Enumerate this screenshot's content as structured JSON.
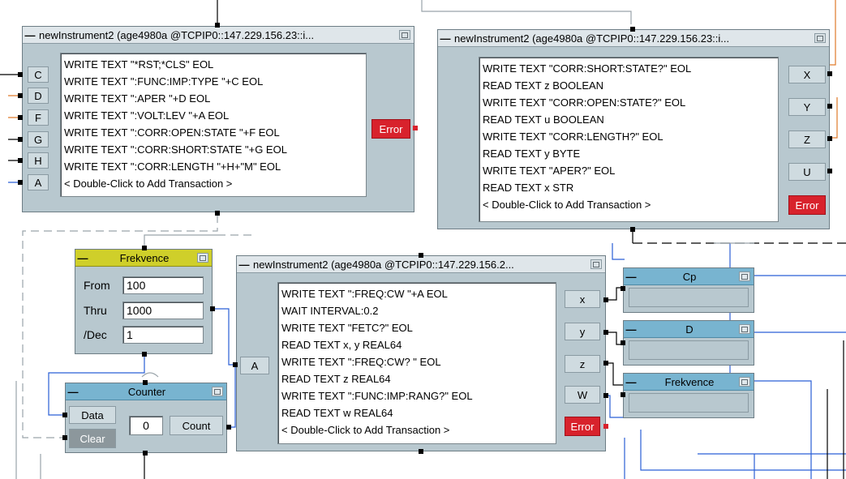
{
  "colors": {
    "object_body": "#b8c8cf",
    "title_bar": "#dfe6ea",
    "yellow_title": "#cfcf2a",
    "blue_title": "#78b4d0",
    "error_pin": "#d8222c",
    "wire_blue": "#2a5fd6",
    "wire_orange": "#e07a2a",
    "wire_gray": "#9aa4aa"
  },
  "icons": {
    "minimize": "minus-icon",
    "maximize": "maximize-icon"
  },
  "inst1": {
    "title": "newInstrument2 (age4980a @TCPIP0::147.229.156.23::i...",
    "inputs": [
      "C",
      "D",
      "F",
      "G",
      "H",
      "A"
    ],
    "transactions": [
      "WRITE TEXT \"*RST;*CLS\" EOL",
      "WRITE TEXT \":FUNC:IMP:TYPE \"+C EOL",
      "WRITE TEXT \":APER \"+D EOL",
      "WRITE TEXT \":VOLT:LEV \"+A EOL",
      "WRITE TEXT \":CORR:OPEN:STATE \"+F EOL",
      "WRITE TEXT \":CORR:SHORT:STATE \"+G EOL",
      "WRITE TEXT \":CORR:LENGTH \"+H+\"M\" EOL",
      "< Double-Click to Add Transaction >"
    ],
    "error_label": "Error"
  },
  "inst2": {
    "title": "newInstrument2 (age4980a @TCPIP0::147.229.156.23::i...",
    "outputs": [
      "X",
      "Y",
      "Z",
      "U"
    ],
    "transactions": [
      "WRITE TEXT \"CORR:SHORT:STATE?\" EOL",
      "READ TEXT z BOOLEAN",
      "WRITE TEXT \"CORR:OPEN:STATE?\" EOL",
      "READ TEXT u BOOLEAN",
      "WRITE TEXT \"CORR:LENGTH?\" EOL",
      "READ TEXT y BYTE",
      "WRITE TEXT \"APER?\" EOL",
      "READ TEXT x STR",
      "< Double-Click to Add Transaction >"
    ],
    "error_label": "Error"
  },
  "inst3": {
    "title": "newInstrument2 (age4980a @TCPIP0::147.229.156.2...",
    "inputs": [
      "A"
    ],
    "outputs": [
      "x",
      "y",
      "z",
      "W"
    ],
    "transactions": [
      "WRITE TEXT \":FREQ:CW \"+A EOL",
      "WAIT INTERVAL:0.2",
      "WRITE TEXT \"FETC?\" EOL",
      "READ TEXT x, y REAL64",
      "WRITE TEXT \":FREQ:CW? \" EOL",
      "READ TEXT z REAL64",
      "WRITE TEXT \":FUNC:IMP:RANG?\" EOL",
      "READ TEXT w REAL64",
      "< Double-Click to Add Transaction >"
    ],
    "error_label": "Error"
  },
  "frekvence_input": {
    "title": "Frekvence",
    "from_label": "From",
    "from_value": "100",
    "thru_label": "Thru",
    "thru_value": "1000",
    "dec_label": "/Dec",
    "dec_value": "1"
  },
  "counter": {
    "title": "Counter",
    "data_label": "Data",
    "clear_label": "Clear",
    "value": "0",
    "count_label": "Count"
  },
  "displays": {
    "cp_title": "Cp",
    "d_title": "D",
    "frekvence_title": "Frekvence"
  }
}
